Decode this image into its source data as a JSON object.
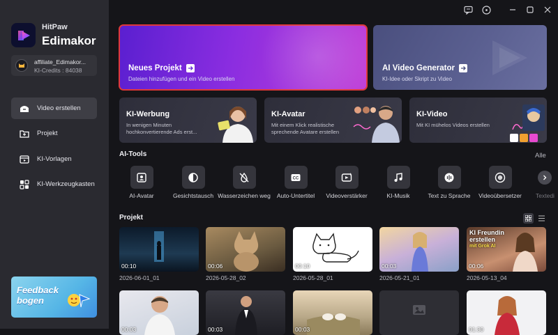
{
  "app": {
    "brand_small": "HitPaw",
    "brand_big": "Edimakor"
  },
  "account": {
    "username": "affiliate_Edimakor...",
    "credits": "KI-Credits : 84038"
  },
  "sidebar": {
    "items": [
      {
        "label": "Video erstellen",
        "icon": "video-icon",
        "active": true
      },
      {
        "label": "Projekt",
        "icon": "folder-icon",
        "active": false
      },
      {
        "label": "KI-Vorlagen",
        "icon": "template-icon",
        "active": false
      },
      {
        "label": "KI-Werkzeugkasten",
        "icon": "toolbox-icon",
        "active": false
      }
    ],
    "feedback": "Feedback bogen"
  },
  "hero": {
    "new_project": {
      "title": "Neues Projekt",
      "subtitle": "Dateien hinzufügen und ein Video erstellen"
    },
    "ai_generator": {
      "title": "AI Video Generator",
      "subtitle": "KI-Idee oder Skript zu Video"
    }
  },
  "features": [
    {
      "title": "KI-Werbung",
      "subtitle": "In wenigen Minuten hochkonvertierende Ads erst..."
    },
    {
      "title": "KI-Avatar",
      "subtitle": "Mit einem Klick realistische sprechende Avatare erstellen"
    },
    {
      "title": "KI-Video",
      "subtitle": "Mit KI mühelos Videos erstellen"
    }
  ],
  "ai_tools": {
    "title": "AI-Tools",
    "all_label": "Alle",
    "items": [
      {
        "label": "AI-Avatar",
        "icon": "avatar-icon"
      },
      {
        "label": "Gesichtstausch",
        "icon": "face-swap-icon"
      },
      {
        "label": "Wasserzeichen weg",
        "icon": "watermark-remove-icon"
      },
      {
        "label": "Auto-Untertitel",
        "icon": "subtitle-icon"
      },
      {
        "label": "Videoverstärker",
        "icon": "video-enhance-icon"
      },
      {
        "label": "KI-Musik",
        "icon": "music-icon"
      },
      {
        "label": "Text zu Sprache",
        "icon": "text-to-speech-icon"
      },
      {
        "label": "Videoübersetzer",
        "icon": "translate-icon"
      },
      {
        "label": "Textedi",
        "icon": "text-edit-icon"
      }
    ]
  },
  "projects": {
    "title": "Projekt",
    "items": [
      {
        "duration": "00:10",
        "date": "2026-06-01_01"
      },
      {
        "duration": "00:06",
        "date": "2026-05-28_02"
      },
      {
        "duration": "00:10",
        "date": "2026-05-28_01"
      },
      {
        "duration": "00:03",
        "date": "2026-05-21_01"
      },
      {
        "duration": "00:06",
        "date": "2026-05-13_04",
        "overlay_title": "KI Freundin erstellen",
        "overlay_sub": "mit Grok AI"
      }
    ],
    "row2_durations": [
      "00:03",
      "00:03",
      "00:03",
      "",
      "01:30"
    ]
  },
  "colors": {
    "accent": "#e0383a",
    "sidebar_bg": "#2a2a30",
    "main_bg": "#151519",
    "purple": "#8a2de0"
  }
}
